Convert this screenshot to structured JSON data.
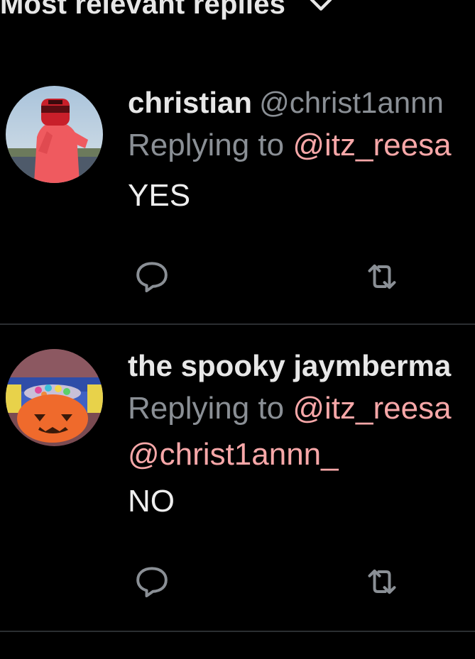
{
  "header": {
    "sort_label": "Most relevant replies",
    "chevron_icon": "chevron-down-icon"
  },
  "colors": {
    "background": "#000000",
    "primary_text": "#e7e7e7",
    "secondary_text": "#8a8f95",
    "mention": "#f7a7a8",
    "divider": "#2b2e31"
  },
  "replies": [
    {
      "display_name": "christian",
      "handle": "@christ1annn",
      "replying_prefix": "Replying to",
      "replying_mentions": [
        "@itz_reesa"
      ],
      "text": "YES",
      "avatar_icon": "user-avatar",
      "actions": {
        "reply_icon": "comment-icon",
        "retweet_icon": "retweet-icon"
      }
    },
    {
      "display_name": "the spooky jaymberma",
      "handle": "",
      "replying_prefix": "Replying to",
      "replying_mentions": [
        "@itz_reesa",
        "@christ1annn_"
      ],
      "text": "NO",
      "avatar_icon": "user-avatar",
      "actions": {
        "reply_icon": "comment-icon",
        "retweet_icon": "retweet-icon"
      }
    }
  ]
}
